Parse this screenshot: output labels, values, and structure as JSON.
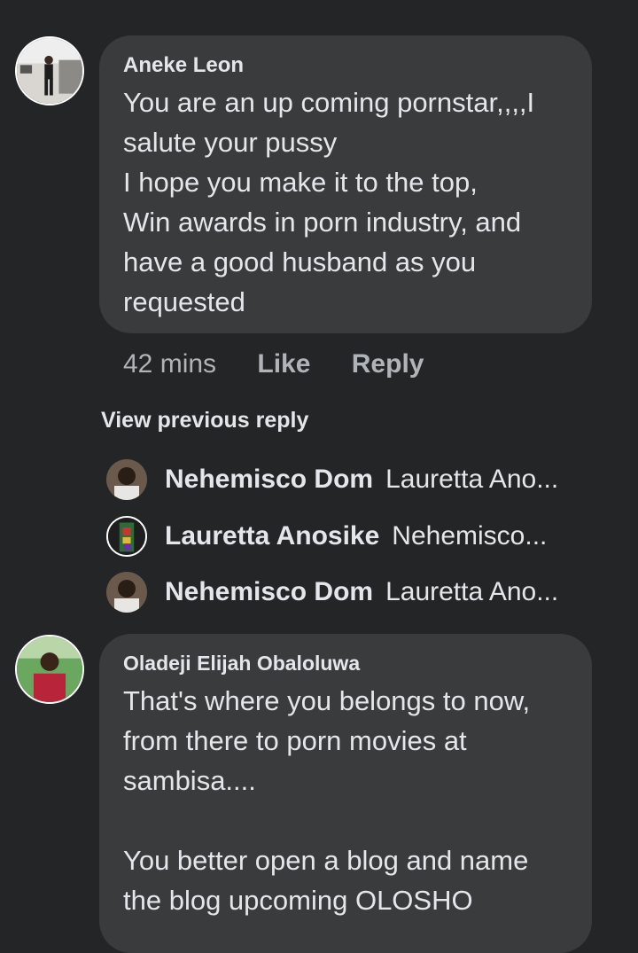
{
  "comments": [
    {
      "author": "Aneke Leon",
      "text": "You are an up coming pornstar,,,,I\nsalute your pussy\nI hope you make it to the top,\nWin awards in porn industry, and\nhave a good husband as you\nrequested",
      "meta": {
        "time": "42 mins",
        "like_label": "Like",
        "reply_label": "Reply"
      }
    },
    {
      "author": "Oladeji Elijah Obaloluwa",
      "text": "That's where you belongs to now,\nfrom there to porn movies at\nsambisa....\n\nYou better open a blog and name\nthe blog upcoming OLOSHO"
    }
  ],
  "replies": {
    "view_previous_label": "View previous reply",
    "items": [
      {
        "name": "Nehemisco Dom",
        "snippet": "Lauretta Ano..."
      },
      {
        "name": "Lauretta Anosike",
        "snippet": "Nehemisco..."
      },
      {
        "name": "Nehemisco Dom",
        "snippet": "Lauretta Ano..."
      }
    ]
  },
  "colors": {
    "background": "#242526",
    "bubble": "#3a3b3c",
    "primary_text": "#e4e6eb",
    "secondary_text": "#b0b3b8"
  }
}
